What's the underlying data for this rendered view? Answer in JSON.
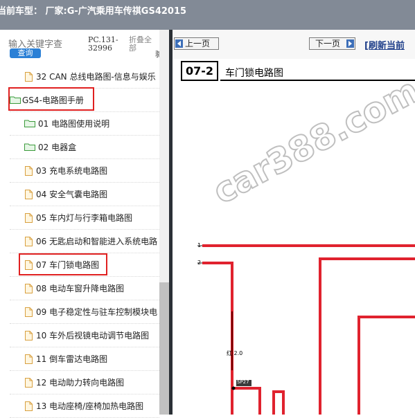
{
  "header": {
    "title": "当前车型： 厂家:G-广汽乘用车传祺GS42015"
  },
  "search": {
    "placeholder": "输入关键字查",
    "button_label": "查询",
    "pc_code": "PC.131-32996",
    "collapse_label": "折叠全部",
    "edge_fragment": "驼"
  },
  "tree": {
    "items": [
      {
        "label": "32 CAN 总线电路图-信息与娱乐",
        "icon": "file-icon"
      },
      {
        "label": "GS4-电路图手册",
        "icon": "folder-icon"
      },
      {
        "label": "01 电路图使用说明",
        "icon": "folder-icon"
      },
      {
        "label": "02 电器盒",
        "icon": "folder-icon"
      },
      {
        "label": "03 充电系统电路图",
        "icon": "file-icon"
      },
      {
        "label": "04 安全气囊电路图",
        "icon": "file-icon"
      },
      {
        "label": "05 车内灯与行李箱电路图",
        "icon": "file-icon"
      },
      {
        "label": "06 无匙启动和智能进入系统电路",
        "icon": "file-icon"
      },
      {
        "label": "07 车门锁电路图",
        "icon": "file-icon"
      },
      {
        "label": "08 电动车窗升降电路图",
        "icon": "file-icon"
      },
      {
        "label": "09 电子稳定性与驻车控制模块电",
        "icon": "file-icon"
      },
      {
        "label": "10 车外后视镜电动调节电路图",
        "icon": "file-icon"
      },
      {
        "label": "11 倒车雷达电路图",
        "icon": "file-icon"
      },
      {
        "label": "12 电动助力转向电路图",
        "icon": "file-icon"
      },
      {
        "label": "13 电动座椅/座椅加热电路图",
        "icon": "file-icon"
      }
    ]
  },
  "viewer": {
    "prev_label": "上一页",
    "next_label": "下一页",
    "refresh_label": "[刷新当前",
    "section_number": "07-2",
    "doc_title": "车门锁电路图",
    "watermark": "car388.com",
    "pin_1": "1",
    "pin_2": "2",
    "wire_label": "红 2.0",
    "splice_label": "SP27"
  },
  "colors": {
    "topbar": "#828a96",
    "highlight": "#e02020",
    "wire": "#e0222e",
    "search_button": "#2b80d6",
    "divider": "#2b3036",
    "link": "#1f3f8a"
  }
}
